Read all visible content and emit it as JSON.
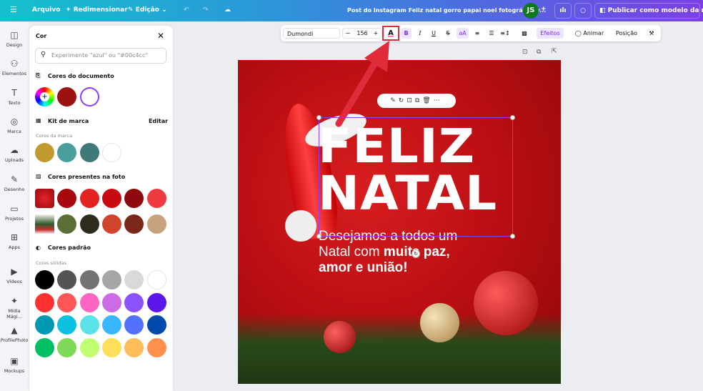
{
  "topbar": {
    "menu_icon": "hamburger-icon",
    "file": "Arquivo",
    "resize": "Redimensionar",
    "edit": "Edição",
    "title": "Post do Instagram Feliz natal gorro papai noel fotográfico v...",
    "avatar": "JS",
    "publish": "Publicar como modelo da marca"
  },
  "rail": [
    {
      "label": "Design",
      "icon": "◫"
    },
    {
      "label": "Elementos",
      "icon": "⚇"
    },
    {
      "label": "Texto",
      "icon": "T"
    },
    {
      "label": "Marca",
      "icon": "◎"
    },
    {
      "label": "Uploads",
      "icon": "☁"
    },
    {
      "label": "Desenho",
      "icon": "✎"
    },
    {
      "label": "Projetos",
      "icon": "▭"
    },
    {
      "label": "Apps",
      "icon": "⊞"
    },
    {
      "label": "Vídeos",
      "icon": "▶"
    },
    {
      "label": "Mídia Mági...",
      "icon": "✦"
    },
    {
      "label": "ProfilePhoto",
      "icon": "▲"
    },
    {
      "label": "Mockups",
      "icon": "▣"
    }
  ],
  "panel": {
    "title": "Cor",
    "search_placeholder": "Experimente \"azul\" ou \"#00c4cc\"",
    "doc_colors_title": "Cores do documento",
    "doc_colors": [
      "#9a1212",
      "#ffffff"
    ],
    "brand_title": "Kit de marca",
    "brand_edit": "Editar",
    "brand_sub": "Cores da marca",
    "brand_colors": [
      "#c09a2e",
      "#4a9e9c",
      "#3f7a78",
      "#ffffff"
    ],
    "photo_title": "Cores presentes na foto",
    "photo_row1": [
      "#a5080d",
      "#e32222",
      "#c80b10",
      "#8f0a0f",
      "#ef3a3f"
    ],
    "photo_row2": [
      "#5a6e35",
      "#2e2a1c",
      "#d0432c",
      "#7a2818",
      "#c8a27e"
    ],
    "default_title": "Cores padrão",
    "default_sub": "Cores sólidas",
    "solid": [
      "#000000",
      "#545454",
      "#737373",
      "#a6a6a6",
      "#d9d9d9",
      "#ffffff",
      "#ff3131",
      "#ff5757",
      "#ff66c4",
      "#cb6ce6",
      "#8c52ff",
      "#5e17eb",
      "#0097b2",
      "#0cc0df",
      "#5ce1e6",
      "#38b6ff",
      "#5271ff",
      "#004aad",
      "#00bf63",
      "#7ed957",
      "#c1ff72",
      "#ffde59",
      "#ffbd59",
      "#ff914d"
    ]
  },
  "toolbar": {
    "font": "Dumondi",
    "size": "156",
    "minus": "−",
    "plus": "+",
    "bold": "B",
    "italic": "I",
    "underline": "U",
    "strike": "S",
    "case": "aA",
    "effects": "Efeitos",
    "animate": "Animar",
    "position": "Posição"
  },
  "design": {
    "title1": "FELIZ",
    "title2": "NATAL",
    "line1": "Desejamos a todos um",
    "line2a": "Natal com ",
    "line2b": "muita paz,",
    "line3": "amor e união!"
  },
  "colors": {
    "accent": "#8b3dff",
    "highlight": "#e02b3a"
  }
}
